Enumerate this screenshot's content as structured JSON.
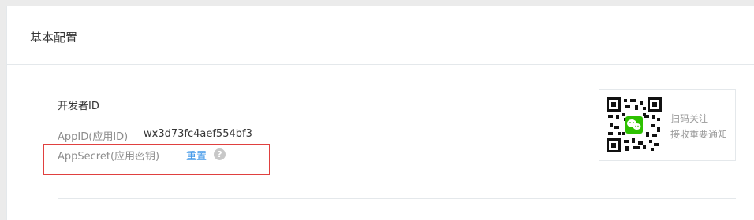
{
  "panel": {
    "title": "基本配置"
  },
  "developer": {
    "section_title": "开发者ID",
    "appid_label": "AppID(应用ID)",
    "appid_value": "wx3d73fc4aef554bf3",
    "secret_label": "AppSecret(应用密钥)",
    "reset_label": "重置",
    "help_icon": "?"
  },
  "qr": {
    "icon": "wechat-qr-code",
    "line1": "扫码关注",
    "line2": "接收重要通知"
  },
  "colors": {
    "link": "#459ae9",
    "highlight": "#e0403f",
    "wechat_green": "#2dc100"
  }
}
